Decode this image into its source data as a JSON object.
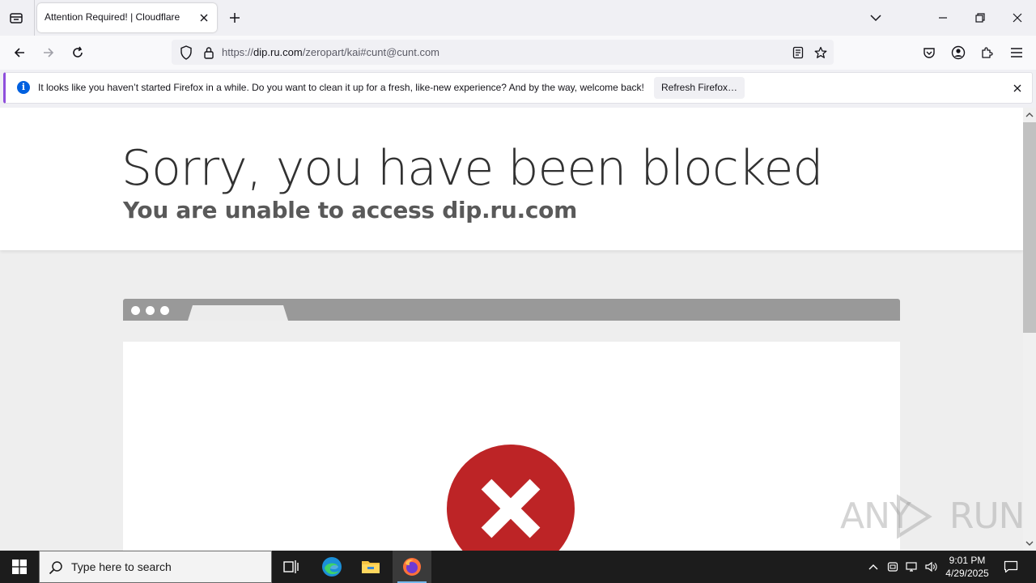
{
  "browser": {
    "tab_title": "Attention Required! | Cloudflare",
    "url_prefix": "https://",
    "url_host": "dip.ru.com",
    "url_path": "/zeropart/kai#cunt@cunt.com"
  },
  "notification": {
    "message": "It looks like you haven’t started Firefox in a while. Do you want to clean it up for a fresh, like-new experience? And by the way, welcome back!",
    "button_label": "Refresh Firefox…",
    "info_glyph": "i"
  },
  "page": {
    "title": "Sorry, you have been blocked",
    "subtitle": "You are unable to access dip.ru.com"
  },
  "watermark": {
    "left": "ANY",
    "right": "RUN"
  },
  "taskbar": {
    "search_placeholder": "Type here to search",
    "time": "9:01 PM",
    "date": "4/29/2025"
  },
  "colors": {
    "error_red": "#bd2426",
    "notification_accent": "#8f4fdc",
    "info_blue": "#0060df",
    "taskbar_bg": "#1c1c1c"
  }
}
